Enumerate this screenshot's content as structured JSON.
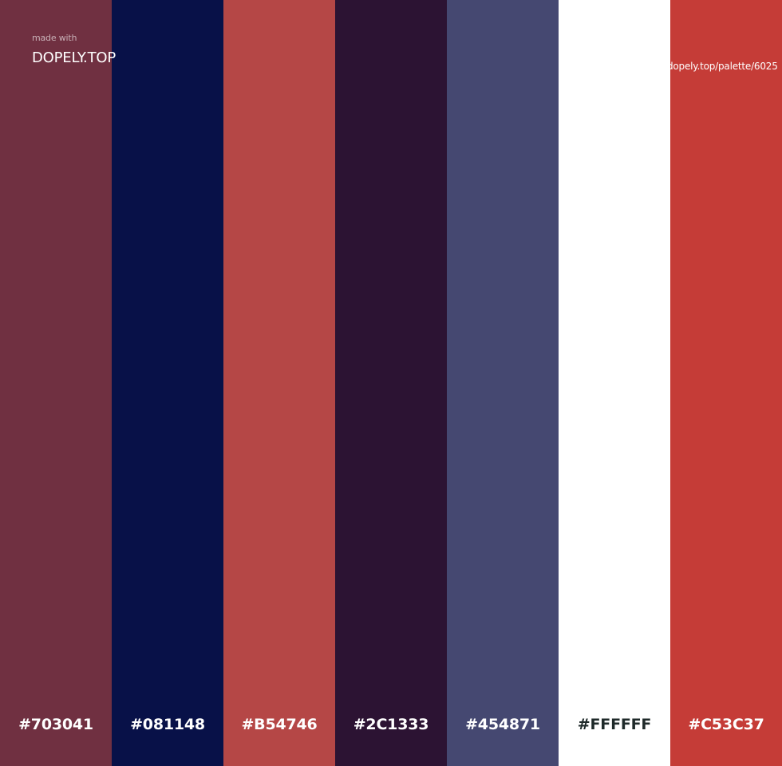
{
  "branding": {
    "made_with": "made with",
    "name": "DOPELY.TOP",
    "url": "dopely.top/palette/6025"
  },
  "palette": [
    {
      "hex": "#703041",
      "color": "#703041",
      "text_color": "#FFFFFF"
    },
    {
      "hex": "#081148",
      "color": "#081148",
      "text_color": "#FFFFFF"
    },
    {
      "hex": "#B54746",
      "color": "#B54746",
      "text_color": "#FFFFFF"
    },
    {
      "hex": "#2C1333",
      "color": "#2C1333",
      "text_color": "#FFFFFF"
    },
    {
      "hex": "#454871",
      "color": "#454871",
      "text_color": "#FFFFFF"
    },
    {
      "hex": "#FFFFFF",
      "color": "#FFFFFF",
      "text_color": "#1F2A2A"
    },
    {
      "hex": "#C53C37",
      "color": "#C53C37",
      "text_color": "#FFFFFF"
    }
  ]
}
